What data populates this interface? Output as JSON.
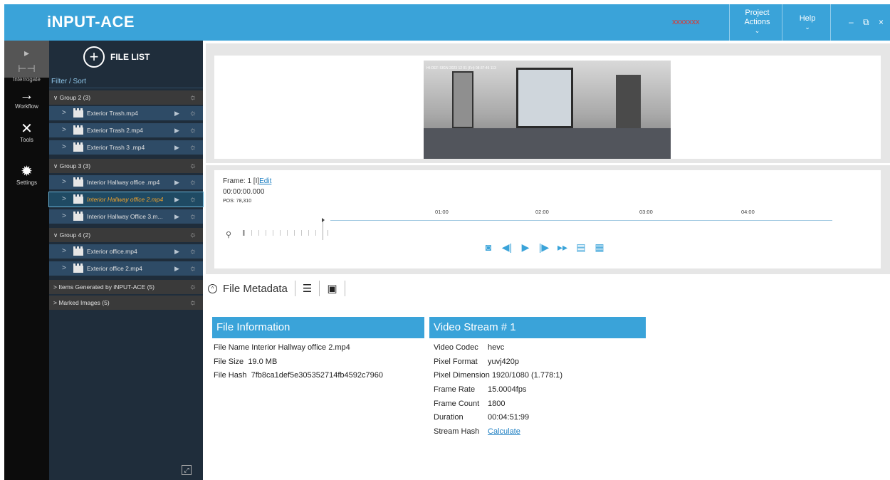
{
  "app": {
    "title": "iNPUT-ACE",
    "status_red": "xxxxxxx",
    "menu_project": "Project Actions",
    "menu_help": "Help",
    "win_min": "–",
    "win_restore": "⧉",
    "win_close": "×"
  },
  "rail": {
    "interrogate": "Interrogate",
    "workflow": "Workflow",
    "tools": "Tools",
    "settings": "Settings"
  },
  "filelist": {
    "header": "FILE LIST",
    "filter": "Filter / Sort",
    "groups": [
      {
        "label": "Group 2 (3)",
        "files": [
          "Exterior Trash.mp4",
          "Exterior Trash 2.mp4",
          "Exterior Trash 3 .mp4"
        ]
      },
      {
        "label": "Group 3 (3)",
        "files": [
          "Interior Hallway office .mp4",
          "Interior Hallway office 2.mp4",
          "Interior Hallway Office 3.m..."
        ]
      },
      {
        "label": "Group 4 (2)",
        "files": [
          "Exterior office.mp4",
          "Exterior office 2.mp4"
        ]
      },
      {
        "label": "Items Generated by iNPUT-ACE (5)",
        "files": []
      },
      {
        "label": "Marked Images (5)",
        "files": []
      }
    ],
    "active_file": "Interior Hallway office 2.mp4"
  },
  "player": {
    "frame_label": "Frame:",
    "frame_value": "1 [I]",
    "frame_edit": "Edit",
    "timecode": "00:00:00.000",
    "pos": "POS: 78,310",
    "video_osd": "HI-DEF-SIGN 2023 12 01 (Fri) 08:37:46 113",
    "ticks": [
      "01:00",
      "02:00",
      "03:00",
      "04:00"
    ]
  },
  "metadata": {
    "header": "File Metadata",
    "file_info": {
      "title": "File Information",
      "name_label": "File Name",
      "name": "Interior Hallway office 2.mp4",
      "size_label": "File Size",
      "size": "19.0 MB",
      "hash_label": "File Hash",
      "hash": "7fb8ca1def5e305352714fb4592c7960"
    },
    "video_stream": {
      "title": "Video Stream # 1",
      "codec_label": "Video Codec",
      "codec": "hevc",
      "pixfmt_label": "Pixel Format",
      "pixfmt": "yuvj420p",
      "dim_label": "Pixel Dimension",
      "dim": "1920/1080 (1.778:1)",
      "rate_label": "Frame Rate",
      "rate": "15.0004fps",
      "count_label": "Frame Count",
      "count": "1800",
      "dur_label": "Duration",
      "dur": "00:04:51:99",
      "hash_label": "Stream Hash",
      "hash_link": "Calculate"
    }
  }
}
